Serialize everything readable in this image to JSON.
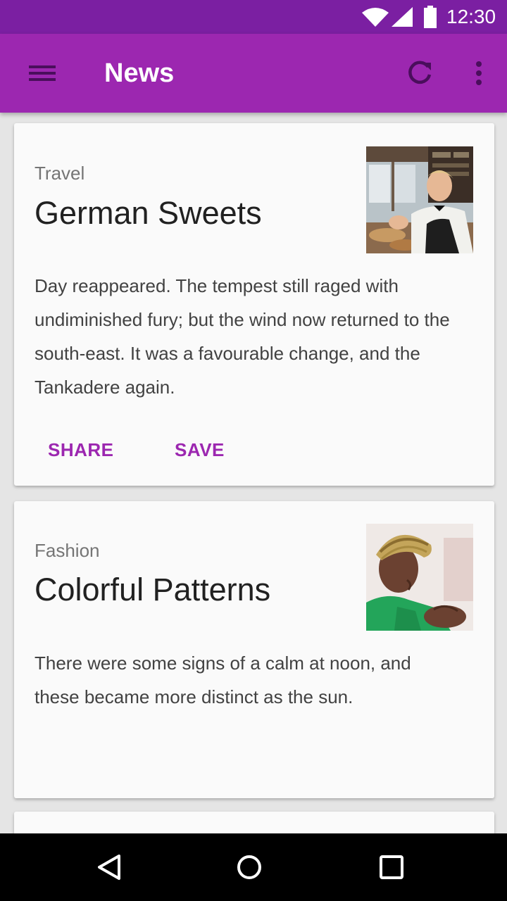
{
  "status_bar": {
    "time": "12:30",
    "icons": [
      "wifi-icon",
      "signal-icon",
      "battery-icon"
    ]
  },
  "app_bar": {
    "title": "News",
    "color": "#9c27b0",
    "status_color": "#7b1fa2",
    "icons": [
      "menu-icon",
      "refresh-icon",
      "more-vert-icon"
    ]
  },
  "cards": [
    {
      "category": "Travel",
      "headline": "German Sweets",
      "body": "Day reappeared. The tempest still raged with undiminished fury; but the wind now returned to the south-east. It was a favourable change, and the Tankadere again.",
      "actions": {
        "share": "SHARE",
        "save": "SAVE"
      }
    },
    {
      "category": "Fashion",
      "headline": "Colorful Patterns",
      "body": "There were some signs of a calm at noon, and these became more distinct as the sun."
    }
  ],
  "accent_color": "#9c27b0",
  "nav_bar": {
    "icons": [
      "back-icon",
      "home-icon",
      "recents-icon"
    ]
  }
}
